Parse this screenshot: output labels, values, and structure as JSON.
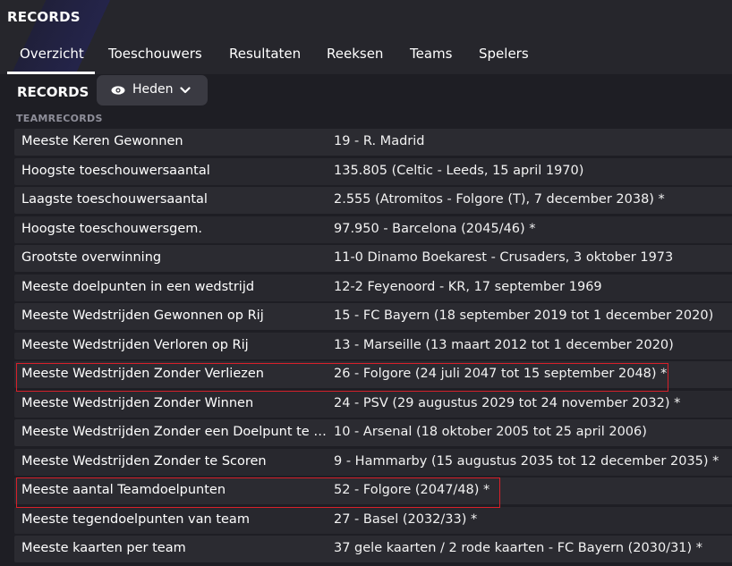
{
  "header": {
    "title": "RECORDS",
    "tabs": [
      "Overzicht",
      "Toeschouwers",
      "Resultaten",
      "Reeksen",
      "Teams",
      "Spelers"
    ],
    "active_tab": "Overzicht"
  },
  "records_bar": {
    "label": "RECORDS",
    "dropdown": {
      "icon": "eye-icon",
      "value": "Heden",
      "chevron": "chevron-down-icon"
    }
  },
  "section": {
    "label": "TEAMRECORDS"
  },
  "records": [
    {
      "name": "Meeste Keren Gewonnen",
      "value": "19 - R. Madrid"
    },
    {
      "name": "Hoogste toeschouwersaantal",
      "value": "135.805 (Celtic - Leeds, 15 april 1970)"
    },
    {
      "name": "Laagste toeschouwersaantal",
      "value": "2.555 (Atromitos - Folgore (T), 7 december 2038) *"
    },
    {
      "name": "Hoogste toeschouwersgem.",
      "value": "97.950 - Barcelona (2045/46) *"
    },
    {
      "name": "Grootste overwinning",
      "value": "11-0 Dinamo Boekarest - Crusaders, 3 oktober 1973"
    },
    {
      "name": "Meeste doelpunten in een wedstrijd",
      "value": "12-2 Feyenoord - KR, 17 september 1969"
    },
    {
      "name": "Meeste Wedstrijden Gewonnen op Rij",
      "value": "15 - FC Bayern (18 september 2019 tot 1 december 2020)"
    },
    {
      "name": "Meeste Wedstrijden Verloren op Rij",
      "value": "13 - Marseille (13 maart 2012 tot 1 december 2020)"
    },
    {
      "name": "Meeste Wedstrijden Zonder Verliezen",
      "value": "26 - Folgore (24 juli 2047 tot 15 september 2048) *"
    },
    {
      "name": "Meeste Wedstrijden Zonder Winnen",
      "value": "24 - PSV (29 augustus 2029 tot 24 november 2032) *"
    },
    {
      "name": "Meeste Wedstrijden Zonder een Doelpunt te I...",
      "value": "10 - Arsenal (18 oktober 2005 tot 25 april 2006)"
    },
    {
      "name": "Meeste Wedstrijden Zonder te Scoren",
      "value": "9 - Hammarby (15 augustus 2035 tot 12 december 2035) *"
    },
    {
      "name": "Meeste aantal Teamdoelpunten",
      "value": "52 - Folgore (2047/48) *"
    },
    {
      "name": "Meeste tegendoelpunten van team",
      "value": "27 - Basel (2032/33) *"
    },
    {
      "name": "Meeste kaarten per team",
      "value": "37 gele kaarten / 2 rode kaarten - FC Bayern (2030/31) *"
    }
  ],
  "colors": {
    "highlight": "#d8202a",
    "background": "#1e1e24",
    "row": "#2b2b31"
  }
}
